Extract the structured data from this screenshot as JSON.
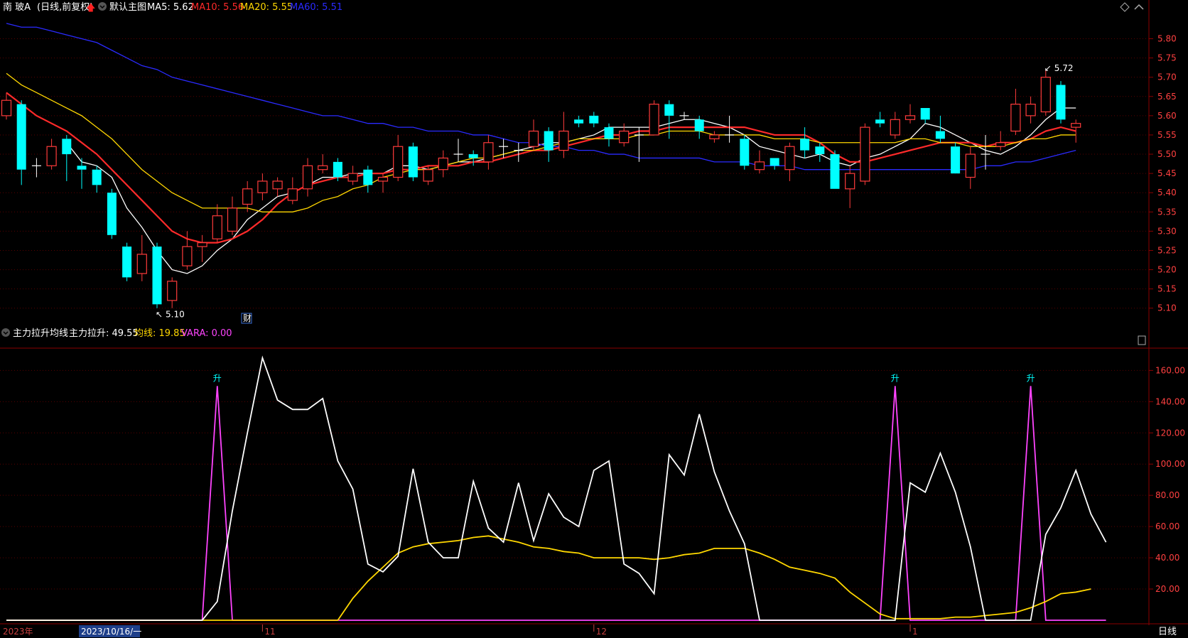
{
  "header": {
    "stock": "南 玻A",
    "mode": "(日线,前复权)",
    "template": "默认主图",
    "ma": [
      {
        "label": "MA5: 5.62",
        "color": "#ffffff"
      },
      {
        "label": "MA10: 5.56",
        "color": "#ff2a2a"
      },
      {
        "label": "MA20: 5.55",
        "color": "#ffd700"
      },
      {
        "label": "MA60: 5.51",
        "color": "#2a2aff"
      }
    ]
  },
  "indicator_header": {
    "name": "主力拉升均线",
    "items": [
      {
        "label": "主力拉升: 49.55",
        "color": "#ffffff"
      },
      {
        "label": "均线: 19.85",
        "color": "#ffd700"
      },
      {
        "label": "VARA: 0.00",
        "color": "#ff44ff"
      }
    ]
  },
  "footer": {
    "year": "2023年",
    "cursor_date": "2023/10/16/一",
    "months": [
      {
        "label": "11",
        "index": 17
      },
      {
        "label": "12",
        "index": 39
      },
      {
        "label": "1",
        "index": 60
      }
    ],
    "period": "日线"
  },
  "annotations": {
    "low": "5.10",
    "high": "5.72",
    "finance": "财",
    "rise": "升"
  },
  "chart_data": [
    {
      "type": "candlestick",
      "ylim": [
        5.07,
        5.86
      ],
      "yticks": [
        5.1,
        5.15,
        5.2,
        5.25,
        5.3,
        5.35,
        5.4,
        5.45,
        5.5,
        5.55,
        5.6,
        5.65,
        5.7,
        5.75,
        5.8
      ],
      "candles": [
        [
          5.6,
          5.64,
          5.66,
          5.59
        ],
        [
          5.63,
          5.46,
          5.64,
          5.42
        ],
        [
          5.47,
          5.47,
          5.49,
          5.44
        ],
        [
          5.47,
          5.52,
          5.54,
          5.46
        ],
        [
          5.54,
          5.5,
          5.55,
          5.43
        ],
        [
          5.47,
          5.46,
          5.49,
          5.41
        ],
        [
          5.46,
          5.42,
          5.47,
          5.4
        ],
        [
          5.4,
          5.29,
          5.41,
          5.28
        ],
        [
          5.26,
          5.18,
          5.27,
          5.17
        ],
        [
          5.19,
          5.24,
          5.29,
          5.17
        ],
        [
          5.26,
          5.11,
          5.27,
          5.1
        ],
        [
          5.12,
          5.17,
          5.18,
          5.1
        ],
        [
          5.21,
          5.26,
          5.3,
          5.2
        ],
        [
          5.26,
          5.27,
          5.29,
          5.22
        ],
        [
          5.28,
          5.34,
          5.37,
          5.27
        ],
        [
          5.3,
          5.36,
          5.39,
          5.29
        ],
        [
          5.37,
          5.41,
          5.43,
          5.35
        ],
        [
          5.4,
          5.43,
          5.45,
          5.38
        ],
        [
          5.41,
          5.43,
          5.44,
          5.39
        ],
        [
          5.38,
          5.41,
          5.44,
          5.37
        ],
        [
          5.41,
          5.47,
          5.49,
          5.39
        ],
        [
          5.46,
          5.47,
          5.5,
          5.45
        ],
        [
          5.48,
          5.44,
          5.49,
          5.43
        ],
        [
          5.43,
          5.45,
          5.47,
          5.42
        ],
        [
          5.46,
          5.42,
          5.47,
          5.4
        ],
        [
          5.43,
          5.44,
          5.45,
          5.4
        ],
        [
          5.44,
          5.52,
          5.55,
          5.43
        ],
        [
          5.52,
          5.44,
          5.53,
          5.43
        ],
        [
          5.43,
          5.46,
          5.47,
          5.42
        ],
        [
          5.46,
          5.49,
          5.51,
          5.44
        ],
        [
          5.5,
          5.5,
          5.54,
          5.48
        ],
        [
          5.5,
          5.49,
          5.51,
          5.47
        ],
        [
          5.48,
          5.53,
          5.55,
          5.46
        ],
        [
          5.52,
          5.52,
          5.54,
          5.49
        ],
        [
          5.51,
          5.51,
          5.53,
          5.48
        ],
        [
          5.52,
          5.56,
          5.59,
          5.51
        ],
        [
          5.56,
          5.51,
          5.57,
          5.48
        ],
        [
          5.51,
          5.56,
          5.61,
          5.49
        ],
        [
          5.59,
          5.58,
          5.6,
          5.57
        ],
        [
          5.6,
          5.58,
          5.61,
          5.57
        ],
        [
          5.57,
          5.54,
          5.58,
          5.52
        ],
        [
          5.53,
          5.56,
          5.58,
          5.52
        ],
        [
          5.55,
          5.55,
          5.57,
          5.48
        ],
        [
          5.55,
          5.63,
          5.64,
          5.55
        ],
        [
          5.63,
          5.6,
          5.64,
          5.54
        ],
        [
          5.6,
          5.6,
          5.61,
          5.59
        ],
        [
          5.59,
          5.56,
          5.6,
          5.54
        ],
        [
          5.54,
          5.55,
          5.56,
          5.53
        ],
        [
          5.55,
          5.55,
          5.6,
          5.53
        ],
        [
          5.54,
          5.47,
          5.55,
          5.46
        ],
        [
          5.46,
          5.48,
          5.51,
          5.45
        ],
        [
          5.49,
          5.47,
          5.49,
          5.46
        ],
        [
          5.46,
          5.52,
          5.53,
          5.43
        ],
        [
          5.54,
          5.51,
          5.57,
          5.49
        ],
        [
          5.52,
          5.5,
          5.53,
          5.48
        ],
        [
          5.5,
          5.41,
          5.51,
          5.41
        ],
        [
          5.41,
          5.45,
          5.47,
          5.36
        ],
        [
          5.43,
          5.57,
          5.58,
          5.42
        ],
        [
          5.59,
          5.58,
          5.61,
          5.57
        ],
        [
          5.55,
          5.59,
          5.61,
          5.54
        ],
        [
          5.59,
          5.6,
          5.63,
          5.58
        ],
        [
          5.62,
          5.59,
          5.62,
          5.58
        ],
        [
          5.56,
          5.54,
          5.6,
          5.53
        ],
        [
          5.52,
          5.45,
          5.53,
          5.45
        ],
        [
          5.44,
          5.5,
          5.52,
          5.41
        ],
        [
          5.5,
          5.5,
          5.55,
          5.46
        ],
        [
          5.52,
          5.53,
          5.56,
          5.51
        ],
        [
          5.56,
          5.63,
          5.67,
          5.55
        ],
        [
          5.6,
          5.63,
          5.65,
          5.58
        ],
        [
          5.61,
          5.7,
          5.72,
          5.6
        ],
        [
          5.68,
          5.59,
          5.69,
          5.58
        ],
        [
          5.57,
          5.58,
          5.59,
          5.53
        ]
      ],
      "series": [
        {
          "name": "MA5",
          "color": "#ffffff",
          "values": [
            null,
            null,
            null,
            null,
            5.53,
            5.48,
            5.47,
            5.44,
            5.36,
            5.31,
            5.25,
            5.2,
            5.19,
            5.21,
            5.25,
            5.28,
            5.33,
            5.36,
            5.39,
            5.4,
            5.42,
            5.44,
            5.44,
            5.45,
            5.45,
            5.45,
            5.47,
            5.47,
            5.46,
            5.47,
            5.48,
            5.48,
            5.49,
            5.5,
            5.51,
            5.52,
            5.53,
            5.53,
            5.54,
            5.55,
            5.57,
            5.57,
            5.57,
            5.57,
            5.58,
            5.59,
            5.59,
            5.58,
            5.57,
            5.55,
            5.52,
            5.51,
            5.5,
            5.49,
            5.5,
            5.48,
            5.47,
            5.49,
            5.5,
            5.52,
            5.54,
            5.58,
            5.57,
            5.55,
            5.53,
            5.51,
            5.5,
            5.52,
            5.55,
            5.59,
            5.62,
            5.62
          ]
        },
        {
          "name": "MA10",
          "color": "#ff2a2a",
          "values": [
            5.66,
            5.63,
            5.6,
            5.58,
            5.56,
            5.53,
            5.5,
            5.46,
            5.42,
            5.38,
            5.34,
            5.3,
            5.28,
            5.27,
            5.27,
            5.28,
            5.3,
            5.33,
            5.37,
            5.4,
            5.42,
            5.43,
            5.44,
            5.44,
            5.45,
            5.45,
            5.46,
            5.46,
            5.47,
            5.47,
            5.47,
            5.48,
            5.48,
            5.49,
            5.5,
            5.51,
            5.51,
            5.52,
            5.53,
            5.54,
            5.55,
            5.55,
            5.56,
            5.56,
            5.57,
            5.57,
            5.57,
            5.57,
            5.57,
            5.57,
            5.56,
            5.55,
            5.55,
            5.55,
            5.53,
            5.5,
            5.48,
            5.48,
            5.49,
            5.5,
            5.51,
            5.52,
            5.53,
            5.53,
            5.53,
            5.52,
            5.53,
            5.53,
            5.54,
            5.56,
            5.57,
            5.56
          ]
        },
        {
          "name": "MA20",
          "color": "#ffd700",
          "values": [
            5.71,
            5.68,
            5.66,
            5.64,
            5.62,
            5.6,
            5.57,
            5.54,
            5.5,
            5.46,
            5.43,
            5.4,
            5.38,
            5.36,
            5.36,
            5.36,
            5.36,
            5.35,
            5.35,
            5.35,
            5.36,
            5.38,
            5.39,
            5.41,
            5.42,
            5.44,
            5.45,
            5.46,
            5.46,
            5.47,
            5.48,
            5.49,
            5.49,
            5.5,
            5.51,
            5.51,
            5.52,
            5.53,
            5.54,
            5.54,
            5.54,
            5.54,
            5.55,
            5.55,
            5.56,
            5.56,
            5.56,
            5.55,
            5.55,
            5.55,
            5.55,
            5.54,
            5.54,
            5.54,
            5.53,
            5.53,
            5.53,
            5.53,
            5.53,
            5.53,
            5.54,
            5.54,
            5.53,
            5.53,
            5.52,
            5.52,
            5.52,
            5.53,
            5.54,
            5.54,
            5.55,
            5.55
          ]
        },
        {
          "name": "MA60",
          "color": "#2a2aff",
          "values": [
            5.84,
            5.83,
            5.83,
            5.82,
            5.81,
            5.8,
            5.79,
            5.77,
            5.75,
            5.73,
            5.72,
            5.7,
            5.69,
            5.68,
            5.67,
            5.66,
            5.65,
            5.64,
            5.63,
            5.62,
            5.61,
            5.6,
            5.6,
            5.59,
            5.58,
            5.58,
            5.57,
            5.57,
            5.56,
            5.56,
            5.56,
            5.55,
            5.55,
            5.54,
            5.53,
            5.53,
            5.52,
            5.52,
            5.51,
            5.51,
            5.5,
            5.5,
            5.49,
            5.49,
            5.49,
            5.49,
            5.49,
            5.48,
            5.48,
            5.48,
            5.47,
            5.47,
            5.47,
            5.46,
            5.46,
            5.46,
            5.46,
            5.46,
            5.46,
            5.46,
            5.46,
            5.46,
            5.46,
            5.46,
            5.46,
            5.47,
            5.47,
            5.48,
            5.48,
            5.49,
            5.5,
            5.51
          ]
        }
      ]
    },
    {
      "type": "line",
      "ylim": [
        0,
        172
      ],
      "yticks": [
        20,
        40,
        60,
        80,
        100,
        120,
        140,
        160
      ],
      "series": [
        {
          "name": "主力拉升",
          "color": "#ffffff",
          "values": [
            0,
            0,
            0,
            0,
            0,
            0,
            0,
            0,
            0,
            0,
            0,
            0,
            0,
            0,
            12,
            70,
            120,
            168,
            141,
            135,
            135,
            142,
            102,
            84,
            36,
            31,
            41,
            97,
            50,
            40,
            40,
            89,
            59,
            50,
            88,
            51,
            81,
            66,
            60,
            96,
            102,
            36,
            30,
            17,
            106,
            93,
            132,
            95,
            70,
            49,
            0,
            0,
            0,
            0,
            0,
            0,
            0,
            0,
            0,
            0,
            88,
            82,
            107,
            82,
            47,
            0,
            0,
            0,
            0,
            55,
            72,
            96,
            68,
            50
          ]
        },
        {
          "name": "均线",
          "color": "#ffd700",
          "values": [
            0,
            0,
            0,
            0,
            0,
            0,
            0,
            0,
            0,
            0,
            0,
            0,
            0,
            0,
            0,
            0,
            0,
            0,
            0,
            0,
            0,
            0,
            0,
            14,
            25,
            34,
            43,
            47,
            49,
            50,
            51,
            53,
            54,
            52,
            50,
            47,
            46,
            44,
            43,
            40,
            40,
            40,
            40,
            39,
            40,
            42,
            43,
            46,
            46,
            46,
            43,
            39,
            34,
            32,
            30,
            27,
            18,
            11,
            4,
            1,
            1,
            1,
            1,
            2,
            2,
            3,
            4,
            5,
            8,
            12,
            17,
            18,
            20
          ]
        },
        {
          "name": "VARA",
          "color": "#ff44ff",
          "values": [
            0,
            0,
            0,
            0,
            0,
            0,
            0,
            0,
            0,
            0,
            0,
            0,
            0,
            0,
            150,
            0,
            0,
            0,
            0,
            0,
            0,
            0,
            0,
            0,
            0,
            0,
            0,
            0,
            0,
            0,
            0,
            0,
            0,
            0,
            0,
            0,
            0,
            0,
            0,
            0,
            0,
            0,
            0,
            0,
            0,
            0,
            0,
            0,
            0,
            0,
            0,
            0,
            0,
            0,
            0,
            0,
            0,
            0,
            0,
            150,
            0,
            0,
            0,
            0,
            0,
            0,
            0,
            0,
            150,
            0,
            0,
            0,
            0,
            0
          ]
        }
      ],
      "signals": [
        14,
        59,
        68
      ]
    }
  ]
}
